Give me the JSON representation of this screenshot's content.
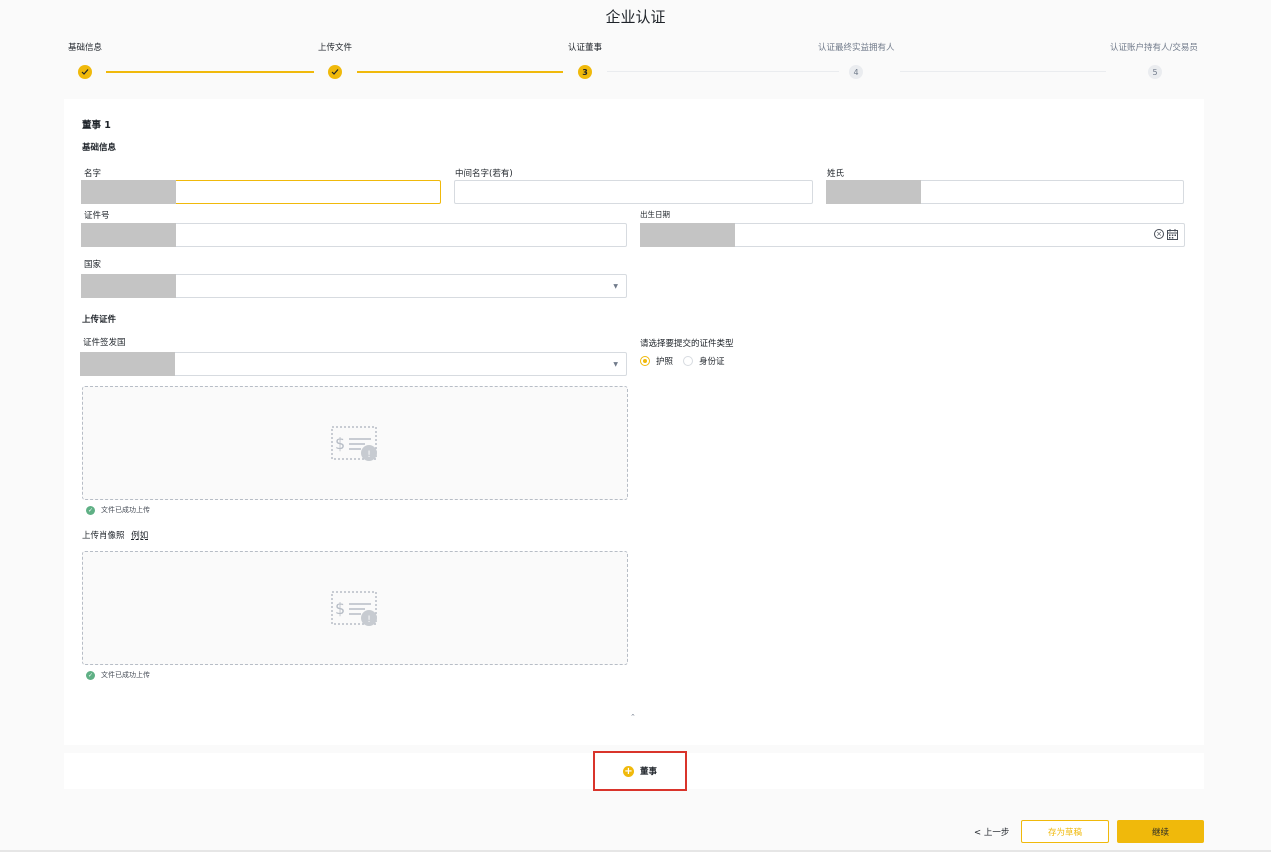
{
  "page": {
    "title": "企业认证"
  },
  "stepper": {
    "steps": [
      {
        "label": "基础信息",
        "status": "done",
        "number": ""
      },
      {
        "label": "上传文件",
        "status": "done",
        "number": ""
      },
      {
        "label": "认证董事",
        "status": "current",
        "number": "3"
      },
      {
        "label": "认证最终实益拥有人",
        "status": "pending",
        "number": "4"
      },
      {
        "label": "认证账户持有人/交易员",
        "status": "pending",
        "number": "5"
      }
    ],
    "check_icon": "check-icon"
  },
  "director": {
    "title": "董事 1",
    "basic_info_title": "基础信息",
    "fields": {
      "first_name": {
        "label": "名字",
        "value": ""
      },
      "middle_name": {
        "label": "中间名字(若有)",
        "value": ""
      },
      "last_name": {
        "label": "姓氏",
        "value": ""
      },
      "id_number": {
        "label": "证件号",
        "value": ""
      },
      "birth_date": {
        "label": "出生日期",
        "value": ""
      },
      "country": {
        "label": "国家",
        "value": ""
      }
    },
    "upload_title": "上传证件",
    "issuing_country": {
      "label": "证件签发国",
      "value": ""
    },
    "doc_type": {
      "label": "请选择要提交的证件类型",
      "options": [
        {
          "label": "护照",
          "checked": true
        },
        {
          "label": "身份证",
          "checked": false
        }
      ]
    },
    "upload_success_text": "文件已成功上传",
    "portrait": {
      "label": "上传肖像照",
      "example": "例如"
    },
    "upload_success_text_2": "文件已成功上传",
    "collapse_glyph": "⌃"
  },
  "add_director": {
    "label": "董事",
    "icon": "plus-circle-icon"
  },
  "footer": {
    "back": "< 上一步",
    "save_draft": "存为草稿",
    "continue": "继续"
  },
  "colors": {
    "accent": "#f0b90b",
    "success": "#5fb085",
    "highlight_border": "#d9342b"
  }
}
